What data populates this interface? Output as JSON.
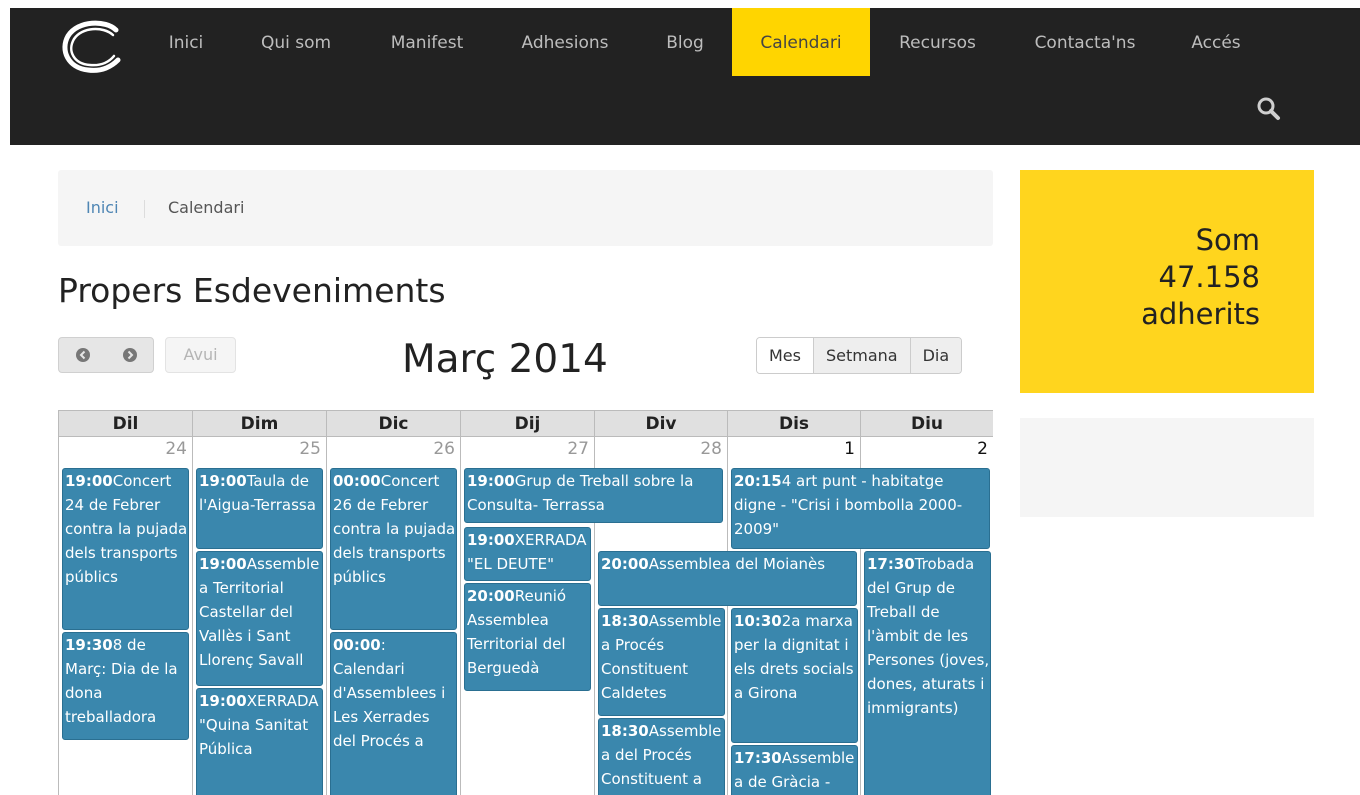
{
  "nav": {
    "items": [
      {
        "label": "Inici"
      },
      {
        "label": "Qui som"
      },
      {
        "label": "Manifest"
      },
      {
        "label": "Adhesions"
      },
      {
        "label": "Blog"
      },
      {
        "label": "Calendari",
        "active": true
      },
      {
        "label": "Recursos"
      },
      {
        "label": "Contacta'ns"
      },
      {
        "label": "Accés"
      }
    ],
    "search_icon": "search-icon",
    "colors": {
      "bar": "#222222",
      "active": "#ffd500",
      "text": "#bdbdbd"
    }
  },
  "breadcrumb": {
    "home": "Inici",
    "current": "Calendari"
  },
  "page_title": "Propers Esdeveniments",
  "calendar": {
    "today_label": "Avui",
    "month_title": "Març 2014",
    "views": [
      "Mes",
      "Setmana",
      "Dia"
    ],
    "active_view": "Mes",
    "weekdays": [
      "Dil",
      "Dim",
      "Dic",
      "Dij",
      "Div",
      "Dis",
      "Diu"
    ],
    "day_numbers": [
      "24",
      "25",
      "26",
      "27",
      "28",
      "1",
      "2"
    ],
    "event_color": "#3a87ad",
    "events": [
      {
        "time": "19:00",
        "title": "Concert 24 de Febrer contra la pujada dels transports públics"
      },
      {
        "time": "19:30",
        "title": "8 de Març: Dia de la dona treballadora"
      },
      {
        "time": "19:00",
        "title": "Taula de l'Aigua-Terrassa"
      },
      {
        "time": "19:00",
        "title": "Assemblea Territorial Castellar del Vallès i Sant Llorenç Savall"
      },
      {
        "time": "19:00",
        "title": "XERRADA \"Quina Sanitat Pública"
      },
      {
        "time": "00:00",
        "title": "Concert 26 de Febrer contra la pujada dels transports públics"
      },
      {
        "time": "00:00",
        "title": ": Calendari d'Assemblees i Les Xerrades del Procés a"
      },
      {
        "time": "19:00",
        "title": "Grup de Treball sobre la Consulta- Terrassa"
      },
      {
        "time": "19:00",
        "title": "XERRADA \"EL DEUTE\""
      },
      {
        "time": "20:00",
        "title": "Reunió Assemblea Territorial del Berguedà"
      },
      {
        "time": "20:15",
        "title": "4 art punt - habitatge digne - \"Crisi i bombolla 2000-2009\""
      },
      {
        "time": "20:00",
        "title": "Assemblea del Moianès"
      },
      {
        "time": "18:30",
        "title": "Assemblea Procés Constituent Caldetes"
      },
      {
        "time": "18:30",
        "title": "Assemblea del Procés Constituent a"
      },
      {
        "time": "10:30",
        "title": "2a marxa per la dignitat i els drets socials a Girona"
      },
      {
        "time": "17:30",
        "title": "Assemblea de Gràcia -"
      },
      {
        "time": "17:30",
        "title": "Trobada del Grup de Treball de l'àmbit de les Persones (joves, dones, aturats i immigrants)"
      }
    ]
  },
  "sidebar": {
    "line1": "Som",
    "line2": "47.158",
    "line3": "adherits",
    "color": "#ffd51e"
  }
}
